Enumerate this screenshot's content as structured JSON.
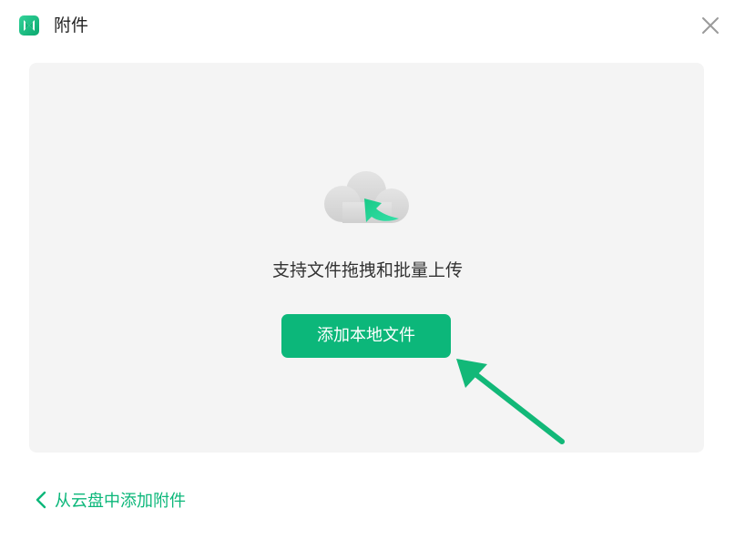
{
  "header": {
    "title": "附件",
    "logo_icon": "app-logo-icon",
    "close_icon": "close-icon"
  },
  "drop_zone": {
    "icon": "cloud-upload-icon",
    "hint": "支持文件拖拽和批量上传",
    "add_local_label": "添加本地文件"
  },
  "footer": {
    "cloud_link_icon": "chevron-left-icon",
    "cloud_link_label": "从云盘中添加附件"
  },
  "colors": {
    "accent": "#0cb77a",
    "background": "#ffffff",
    "drop_zone_bg": "#f4f4f4",
    "text": "#333333",
    "close_icon": "#9a9a9a"
  }
}
